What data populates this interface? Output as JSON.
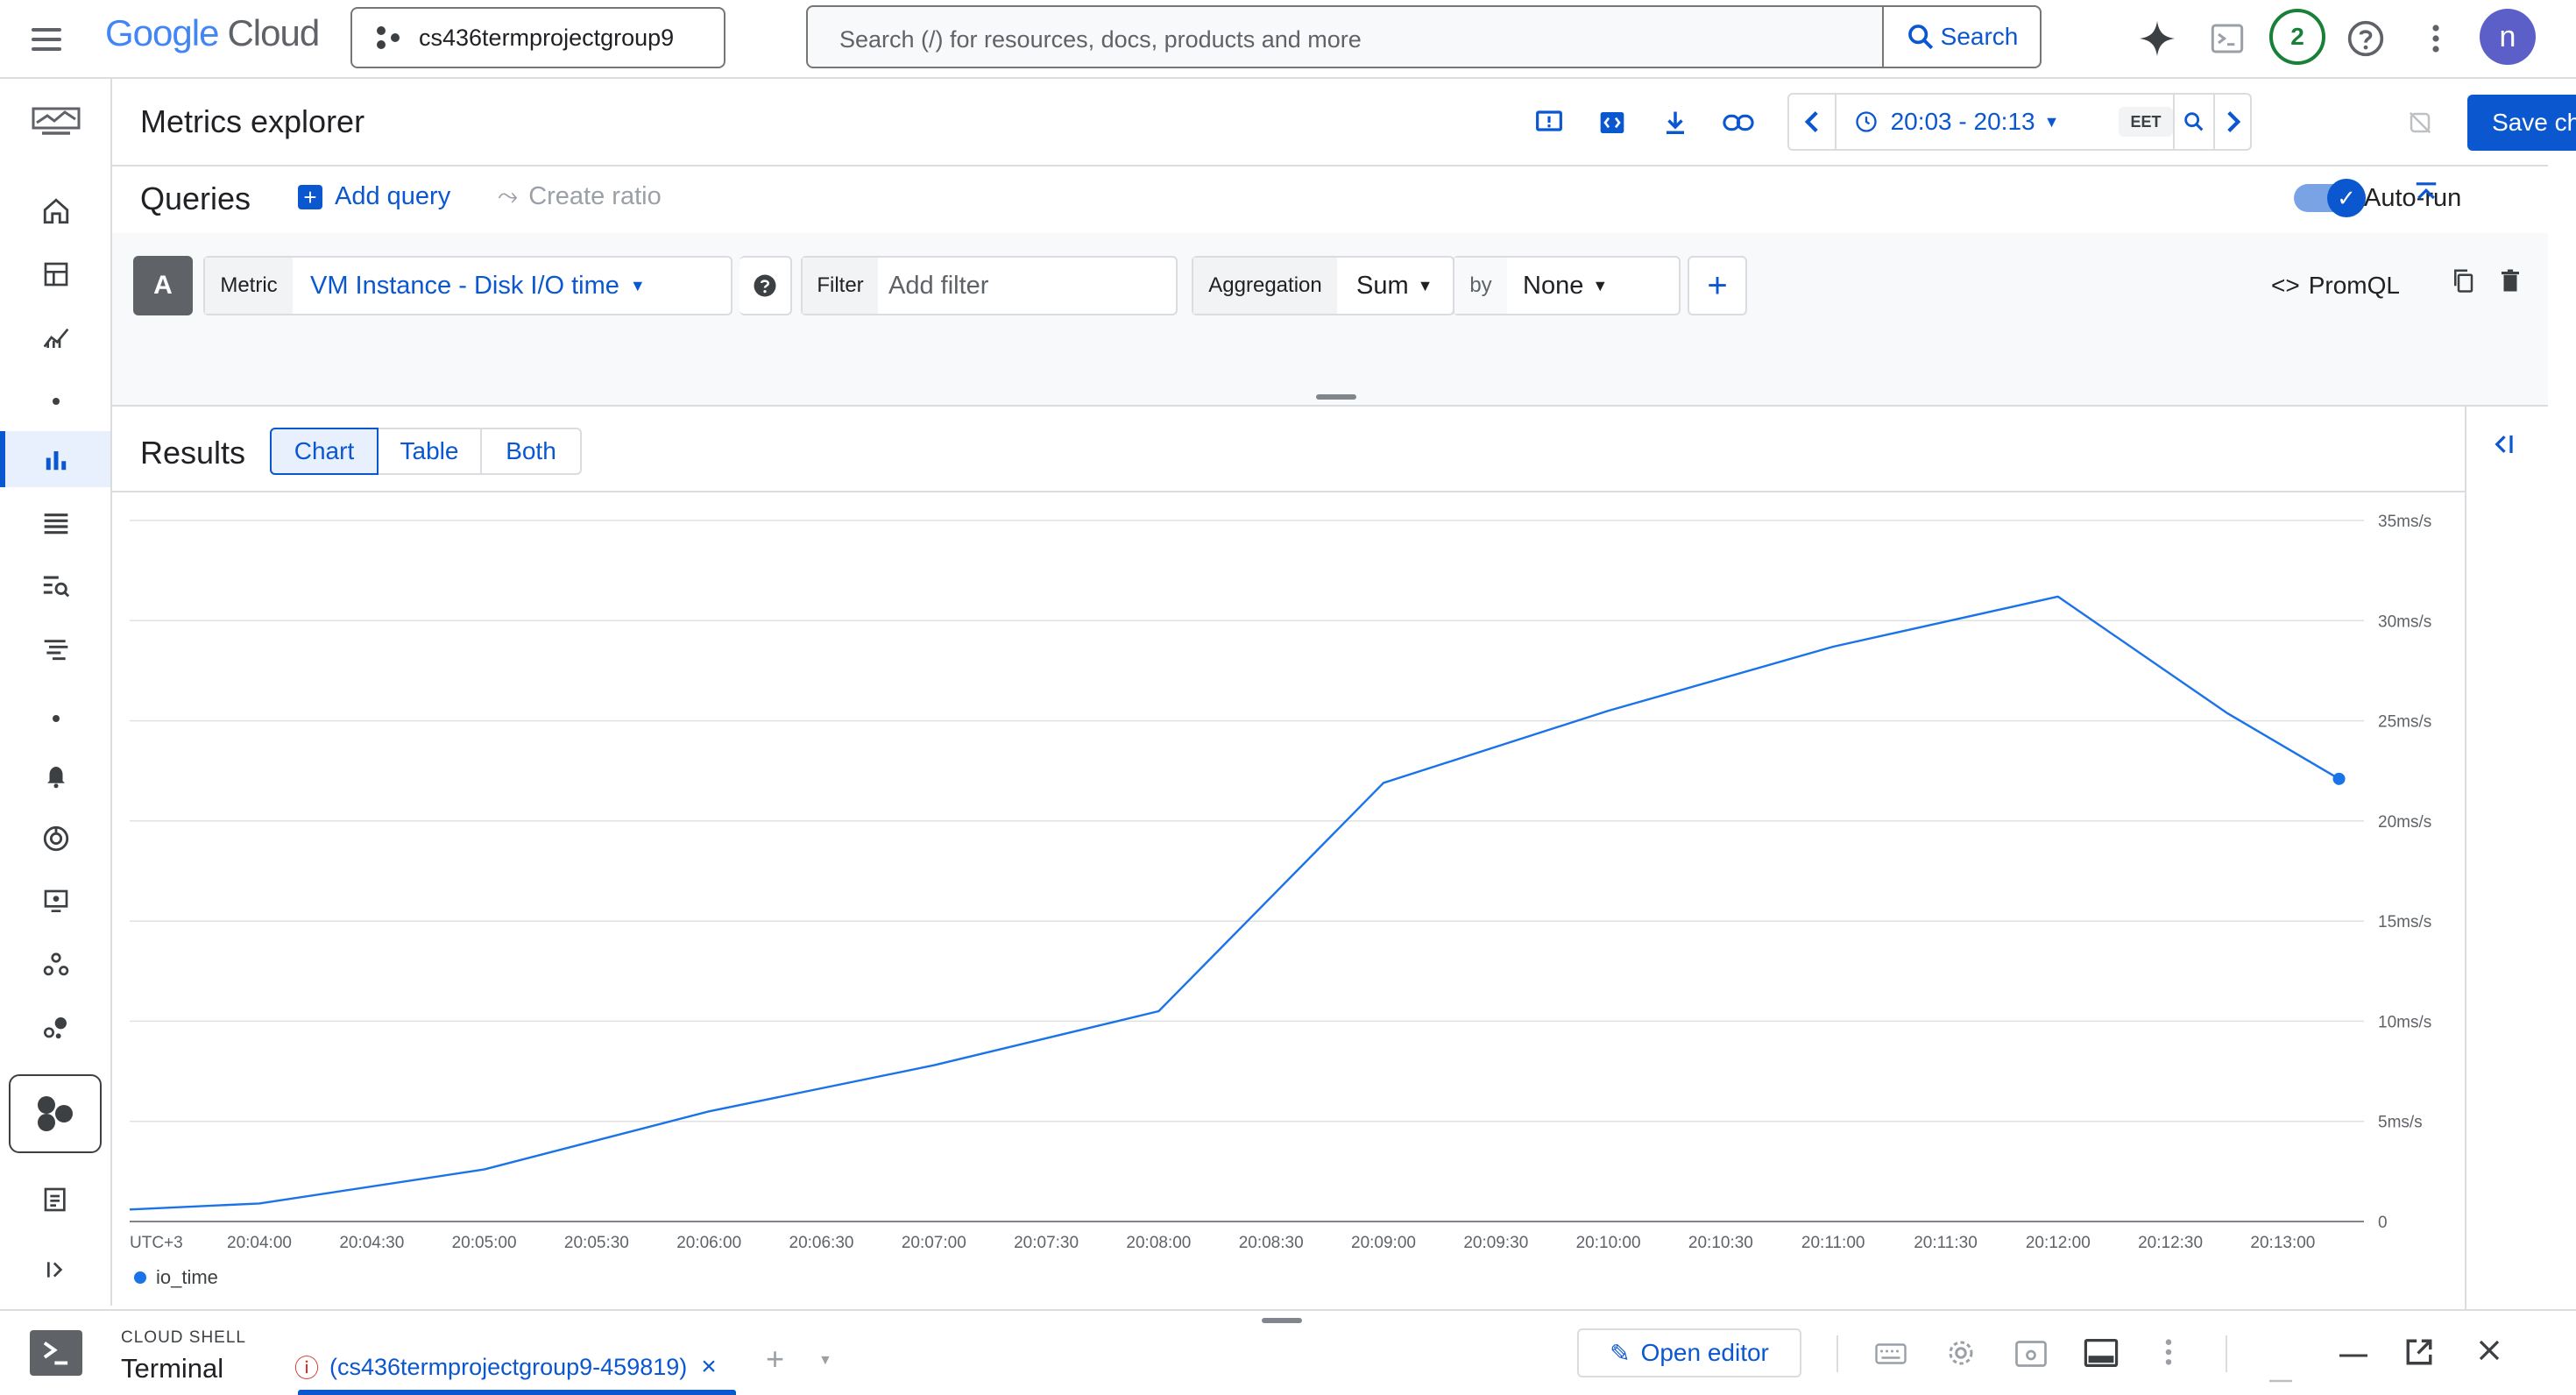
{
  "topbar": {
    "logo_google": "Google",
    "logo_cloud": "Cloud",
    "project": "cs436termprojectgroup9",
    "search_placeholder": "Search (/) for resources, docs, products and more",
    "search_button": "Search",
    "notification_count": "2",
    "avatar_letter": "n"
  },
  "header": {
    "title": "Metrics explorer",
    "time_range": "20:03 - 20:13",
    "timezone": "EET",
    "save_label": "Save chart"
  },
  "queries": {
    "title": "Queries",
    "add_query": "Add query",
    "create_ratio": "Create ratio",
    "autorun_label": "Auto-run",
    "query_letter": "A",
    "metric_label": "Metric",
    "metric_value": "VM Instance - Disk I/O time",
    "filter_label": "Filter",
    "filter_placeholder": "Add filter",
    "aggregation_label": "Aggregation",
    "aggregation_value": "Sum",
    "by_label": "by",
    "by_value": "None",
    "promql_label": "PromQL"
  },
  "results": {
    "title": "Results",
    "views": [
      "Chart",
      "Table",
      "Both"
    ],
    "active_view": "Chart"
  },
  "chart_data": {
    "type": "line",
    "x": [
      "20:03:45",
      "20:04:00",
      "20:05:00",
      "20:06:00",
      "20:07:00",
      "20:08:00",
      "20:09:00",
      "20:10:00",
      "20:11:00",
      "20:12:00",
      "20:12:45",
      "20:13:15"
    ],
    "x_ticks": [
      "UTC+3",
      "20:04:00",
      "20:04:30",
      "20:05:00",
      "20:05:30",
      "20:06:00",
      "20:06:30",
      "20:07:00",
      "20:07:30",
      "20:08:00",
      "20:08:30",
      "20:09:00",
      "20:09:30",
      "20:10:00",
      "20:10:30",
      "20:11:00",
      "20:11:30",
      "20:12:00",
      "20:12:30",
      "20:13:00"
    ],
    "y_ticks": [
      "0",
      "5ms/s",
      "10ms/s",
      "15ms/s",
      "20ms/s",
      "25ms/s",
      "30ms/s",
      "35ms/s"
    ],
    "series": [
      {
        "name": "io_time",
        "values": [
          0.6,
          0.9,
          2.6,
          5.5,
          7.8,
          10.5,
          21.9,
          25.5,
          28.7,
          31.2,
          25.4,
          22.1
        ],
        "color": "#1a73e8"
      }
    ],
    "ylim": [
      0,
      35
    ],
    "grid": true,
    "legend": "bottom-left"
  },
  "shell": {
    "label": "CLOUD SHELL",
    "terminal": "Terminal",
    "tab": "(cs436termprojectgroup9-459819)",
    "open_editor": "Open editor"
  }
}
